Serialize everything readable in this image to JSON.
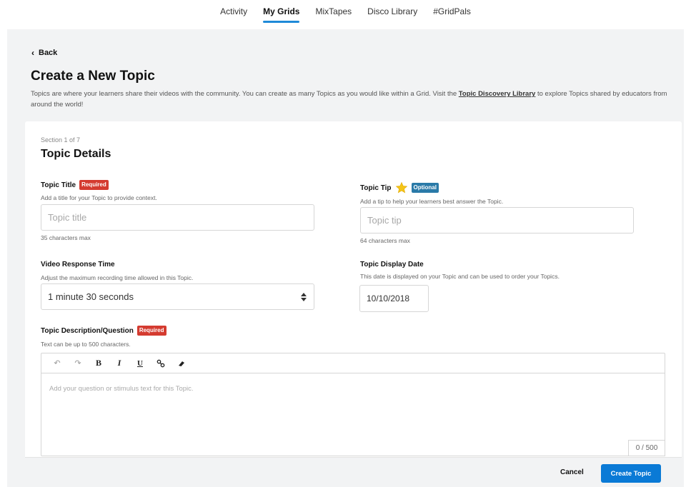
{
  "nav": {
    "items": [
      {
        "label": "Activity"
      },
      {
        "label": "My Grids",
        "active": true
      },
      {
        "label": "MixTapes"
      },
      {
        "label": "Disco Library"
      },
      {
        "label": "#GridPals"
      }
    ],
    "accent_color": "#1f8ad8"
  },
  "back_label": "Back",
  "page_title": "Create a New Topic",
  "intro": {
    "text_before": "Topics are where your learners share their videos with the community. You can create as many Topics as you would like within a Grid. Visit the ",
    "link": "Topic Discovery Library",
    "text_after": " to explore Topics shared by educators from around the world!"
  },
  "section": {
    "label": "Section 1 of 7",
    "title": "Topic Details"
  },
  "fields": {
    "topic_title": {
      "label": "Topic Title",
      "badge": "Required",
      "help": "Add a title for your Topic to provide context.",
      "placeholder": "Topic title",
      "hint": "35 characters max"
    },
    "topic_tip": {
      "label": "Topic Tip",
      "badge": "Optional",
      "help": "Add a tip to help your learners best answer the Topic.",
      "placeholder": "Topic tip",
      "hint": "64 characters max"
    },
    "video_response_time": {
      "label": "Video Response Time",
      "help": "Adjust the maximum recording time allowed in this Topic.",
      "value": "1 minute 30 seconds"
    },
    "topic_display_date": {
      "label": "Topic Display Date",
      "help": "This date is displayed on your Topic and can be used to order your Topics.",
      "value": "10/10/2018"
    },
    "topic_description": {
      "label": "Topic Description/Question",
      "badge": "Required",
      "help": "Text can be up to 500 characters.",
      "placeholder": "Add your question or stimulus text for this Topic.",
      "counter": "0 / 500"
    }
  },
  "toolbar": {
    "undo": "↶",
    "redo": "↷",
    "bold": "B",
    "italic": "I",
    "underline": "U",
    "link": "🔗",
    "clear": "✐"
  },
  "footer": {
    "cancel_label": "Cancel",
    "create_label": "Create Topic"
  },
  "colors": {
    "required": "#d43b30",
    "optional": "#2a7aa8",
    "primary_button": "#0a7ad6"
  }
}
